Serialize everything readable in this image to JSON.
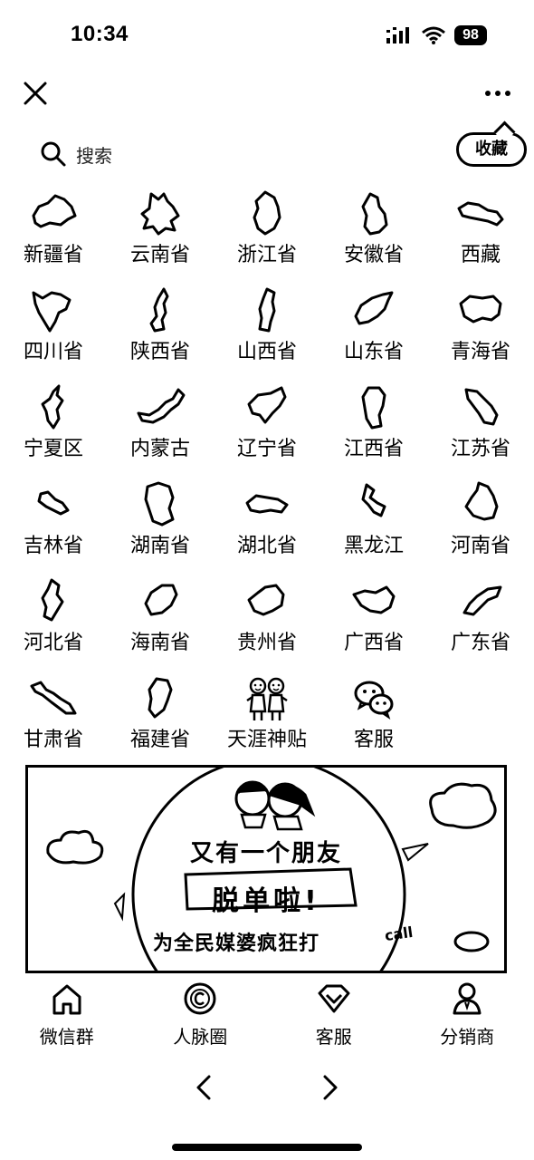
{
  "status_bar": {
    "time": "10:34",
    "battery": "98",
    "icons": [
      "signal-icon",
      "wifi-icon",
      "battery-icon"
    ]
  },
  "top_bar": {
    "icons": [
      "close-icon",
      "more-icon"
    ]
  },
  "search": {
    "placeholder": "搜索",
    "favorite_label": "收藏"
  },
  "grid": {
    "items": [
      {
        "label": "新疆省",
        "icon": "xinjiang-map-icon"
      },
      {
        "label": "云南省",
        "icon": "yunnan-map-icon"
      },
      {
        "label": "浙江省",
        "icon": "zhejiang-map-icon"
      },
      {
        "label": "安徽省",
        "icon": "anhui-map-icon"
      },
      {
        "label": "西藏",
        "icon": "tibet-map-icon"
      },
      {
        "label": "四川省",
        "icon": "sichuan-map-icon"
      },
      {
        "label": "陕西省",
        "icon": "shaanxi-map-icon"
      },
      {
        "label": "山西省",
        "icon": "shanxi-map-icon"
      },
      {
        "label": "山东省",
        "icon": "shandong-map-icon"
      },
      {
        "label": "青海省",
        "icon": "qinghai-map-icon"
      },
      {
        "label": "宁夏区",
        "icon": "ningxia-map-icon"
      },
      {
        "label": "内蒙古",
        "icon": "inner-mongolia-map-icon"
      },
      {
        "label": "辽宁省",
        "icon": "liaoning-map-icon"
      },
      {
        "label": "江西省",
        "icon": "jiangxi-map-icon"
      },
      {
        "label": "江苏省",
        "icon": "jiangsu-map-icon"
      },
      {
        "label": "吉林省",
        "icon": "jilin-map-icon"
      },
      {
        "label": "湖南省",
        "icon": "hunan-map-icon"
      },
      {
        "label": "湖北省",
        "icon": "hubei-map-icon"
      },
      {
        "label": "黑龙江",
        "icon": "heilongjiang-map-icon"
      },
      {
        "label": "河南省",
        "icon": "henan-map-icon"
      },
      {
        "label": "河北省",
        "icon": "hebei-map-icon"
      },
      {
        "label": "海南省",
        "icon": "hainan-map-icon"
      },
      {
        "label": "贵州省",
        "icon": "guizhou-map-icon"
      },
      {
        "label": "广西省",
        "icon": "guangxi-map-icon"
      },
      {
        "label": "广东省",
        "icon": "guangdong-map-icon"
      },
      {
        "label": "甘肃省",
        "icon": "gansu-map-icon"
      },
      {
        "label": "福建省",
        "icon": "fujian-map-icon"
      },
      {
        "label": "天涯神贴",
        "icon": "couple-cartoon-icon"
      },
      {
        "label": "客服",
        "icon": "wechat-icon"
      }
    ]
  },
  "banner": {
    "line1": "又有一个朋友",
    "line2": "脱单啦!",
    "line3": "为全民媒婆疯狂打",
    "line3_tail": "call"
  },
  "bottom_nav": {
    "items": [
      {
        "label": "微信群",
        "icon": "home-icon"
      },
      {
        "label": "人脉圈",
        "icon": "copyright-circle-icon"
      },
      {
        "label": "客服",
        "icon": "heart-diamond-icon"
      },
      {
        "label": "分销商",
        "icon": "person-icon"
      }
    ]
  },
  "browser_nav": {
    "icons": [
      "back-arrow-icon",
      "forward-arrow-icon"
    ]
  }
}
